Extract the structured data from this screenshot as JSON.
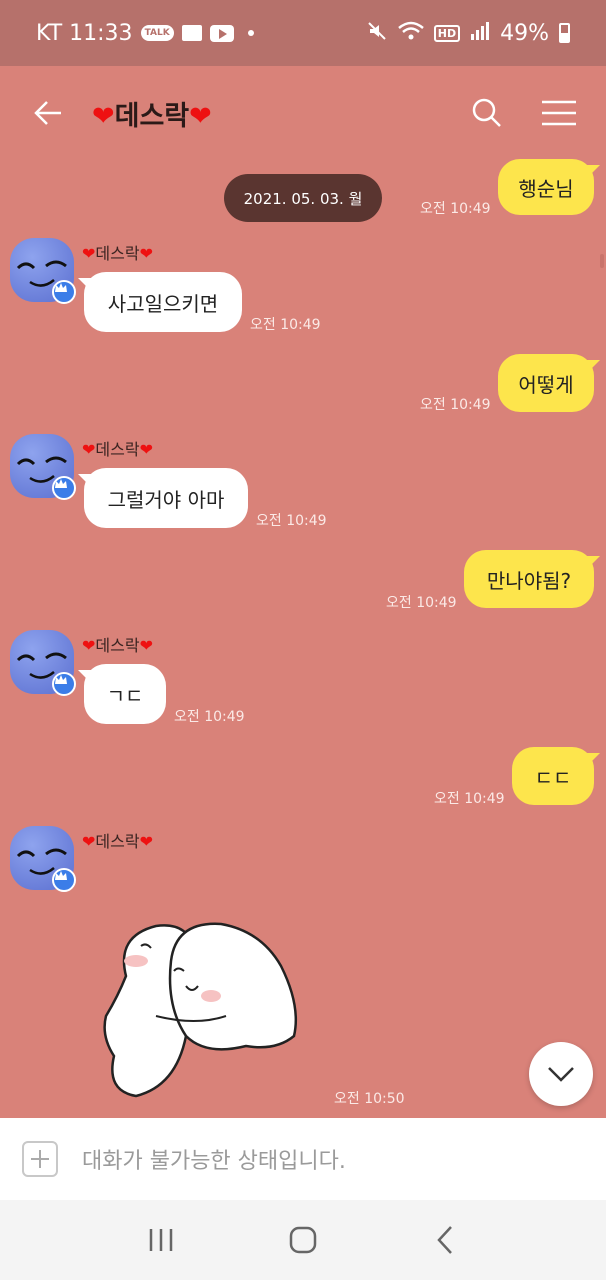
{
  "status_bar": {
    "carrier_time": "KT 11:33",
    "talk_badge": "TALK",
    "hd_badge": "HD",
    "battery_percent": "49%"
  },
  "header": {
    "title": "데스락",
    "title_prefix": "❤",
    "title_suffix": "❤"
  },
  "chat": {
    "date": "2021. 05. 03. 월",
    "messages": [
      {
        "text": "행순님",
        "time": "오전 10:49"
      },
      {
        "sender": "데스락",
        "text": "사고일으키면",
        "time": "오전 10:49"
      },
      {
        "text": "어떻게",
        "time": "오전 10:49"
      },
      {
        "sender": "데스락",
        "text": "그럴거야 아마",
        "time": "오전 10:49"
      },
      {
        "text": "만나야됨?",
        "time": "오전 10:49"
      },
      {
        "sender": "데스락",
        "text": "ㄱㄷ",
        "time": "오전 10:49"
      },
      {
        "text": "ㄷㄷ",
        "time": "오전 10:49"
      },
      {
        "sender": "데스락",
        "text": "",
        "time": "오전 10:50"
      }
    ]
  },
  "input": {
    "placeholder": "대화가 불가능한 상태입니다."
  },
  "colors": {
    "background": "#d98279",
    "status_bar": "#b6716b",
    "my_bubble": "#fde54c",
    "other_bubble": "#ffffff",
    "date_chip": "#5a3530"
  }
}
